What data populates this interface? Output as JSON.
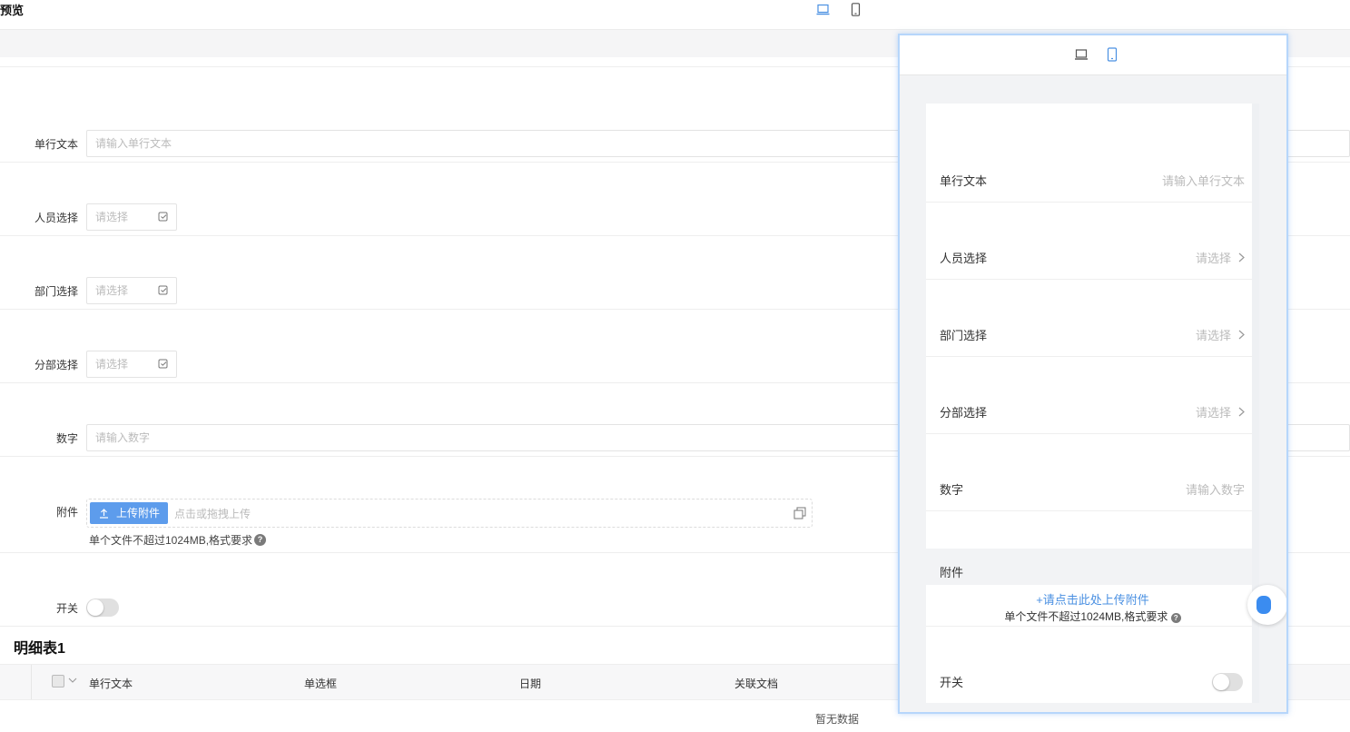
{
  "page": {
    "title": "预览"
  },
  "view_toggle": {
    "desktop_icon": "laptop-icon",
    "mobile_icon": "phone-icon",
    "active": "desktop"
  },
  "form": {
    "single_text": {
      "label": "单行文本",
      "placeholder": "请输入单行文本"
    },
    "person_select": {
      "label": "人员选择",
      "placeholder": "请选择"
    },
    "dept_select": {
      "label": "部门选择",
      "placeholder": "请选择"
    },
    "branch_select": {
      "label": "分部选择",
      "placeholder": "请选择"
    },
    "number": {
      "label": "数字",
      "placeholder": "请输入数字"
    },
    "attachment": {
      "label": "附件",
      "button_label": "上传附件",
      "hint": "点击或拖拽上传",
      "note": "单个文件不超过1024MB,格式要求"
    },
    "switch": {
      "label": "开关",
      "on": false
    }
  },
  "detail_table": {
    "title": "明细表1",
    "columns": [
      "单行文本",
      "单选框",
      "日期",
      "关联文档"
    ],
    "empty_text": "暂无数据"
  },
  "mobile_preview": {
    "active": "mobile",
    "fields": [
      {
        "label": "单行文本",
        "value": "请输入单行文本",
        "arrow": false
      },
      {
        "label": "人员选择",
        "value": "请选择",
        "arrow": true
      },
      {
        "label": "部门选择",
        "value": "请选择",
        "arrow": true
      },
      {
        "label": "分部选择",
        "value": "请选择",
        "arrow": true
      },
      {
        "label": "数字",
        "value": "请输入数字",
        "arrow": false
      }
    ],
    "attachment_label": "附件",
    "upload_link": "+请点击此处上传附件",
    "upload_note": "单个文件不超过1024MB,格式要求",
    "switch_label": "开关",
    "switch_on": false
  },
  "colors": {
    "accent": "#5d9cec",
    "link": "#4a90e2",
    "panel_border": "#b6d6fb"
  }
}
